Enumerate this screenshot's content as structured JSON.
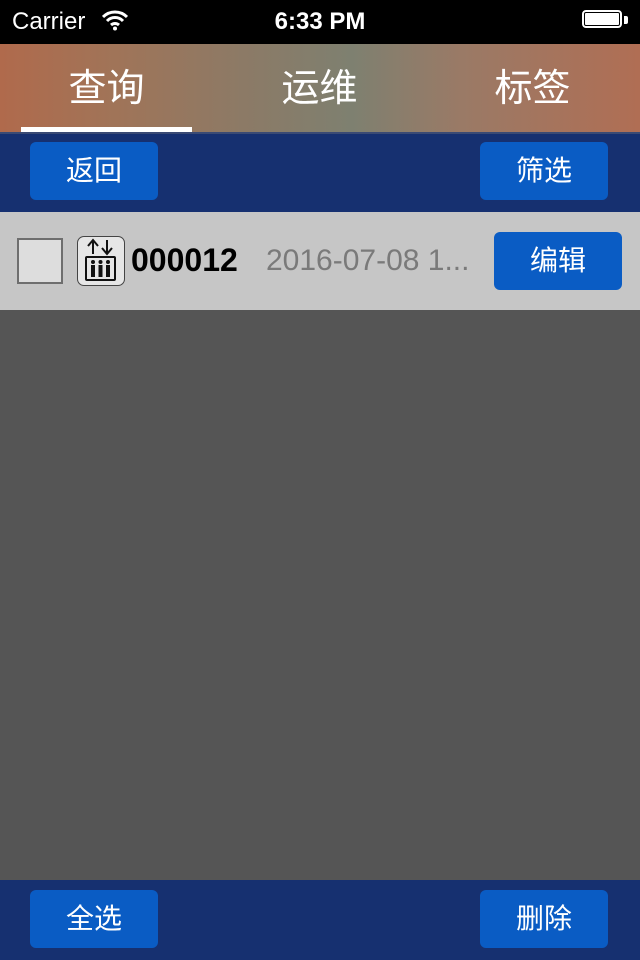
{
  "status_bar": {
    "carrier": "Carrier",
    "time": "6:33 PM",
    "battery_level": 1.0
  },
  "tabs": [
    {
      "label": "查询",
      "selected": true
    },
    {
      "label": "运维",
      "selected": false
    },
    {
      "label": "标签",
      "selected": false
    }
  ],
  "toolbar": {
    "back_label": "返回",
    "filter_label": "筛选"
  },
  "list": {
    "items": [
      {
        "checked": false,
        "icon": "elevator-icon",
        "id": "000012",
        "date": "2016-07-08 1...",
        "edit_label": "编辑"
      }
    ]
  },
  "bottom_toolbar": {
    "select_all_label": "全选",
    "delete_label": "删除"
  },
  "colors": {
    "toolbar_bg": "#163070",
    "button_bg": "#0a5cc4",
    "content_bg": "#555555",
    "row_bg": "#c6c6c6"
  }
}
